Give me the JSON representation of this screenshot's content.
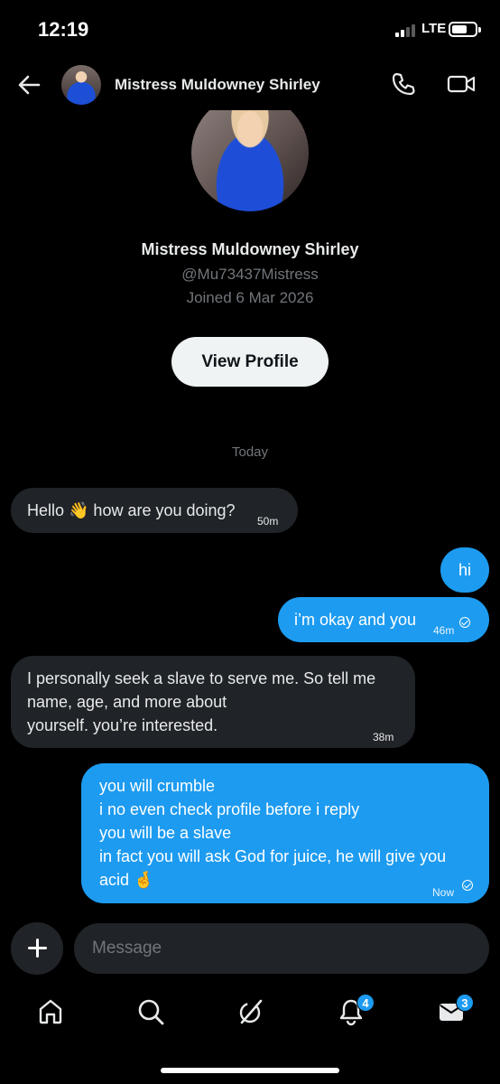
{
  "status_bar": {
    "time": "12:19",
    "network": "LTE"
  },
  "header": {
    "name": "Mistress Muldowney Shirley"
  },
  "profile": {
    "name": "Mistress Muldowney Shirley",
    "handle": "@Mu73437Mistress",
    "joined": "Joined 6 Mar 2026",
    "view_profile_label": "View Profile"
  },
  "date_separator": "Today",
  "messages": [
    {
      "direction": "incoming",
      "text": "Hello 👋 how are you doing?",
      "time": "50m"
    },
    {
      "direction": "outgoing",
      "text": "hi"
    },
    {
      "direction": "outgoing",
      "text": "i’m okay and you",
      "time": "46m"
    },
    {
      "direction": "incoming",
      "lines": [
        "I personally seek a slave to serve me. So tell me",
        "name, age, and more about",
        "yourself. you’re interested."
      ],
      "time": "38m"
    },
    {
      "direction": "outgoing",
      "lines": [
        "you will crumble",
        "i no even check profile before i reply",
        "you will be a slave",
        "in fact you will ask God for juice, he will give you",
        "acid 🤞"
      ],
      "time": "Now"
    }
  ],
  "composer": {
    "placeholder": "Message"
  },
  "nav": {
    "notifications_badge": "4",
    "messages_badge": "3"
  },
  "colors": {
    "accent": "#1d9bf0",
    "incoming_bubble": "#202327",
    "background": "#000000"
  }
}
